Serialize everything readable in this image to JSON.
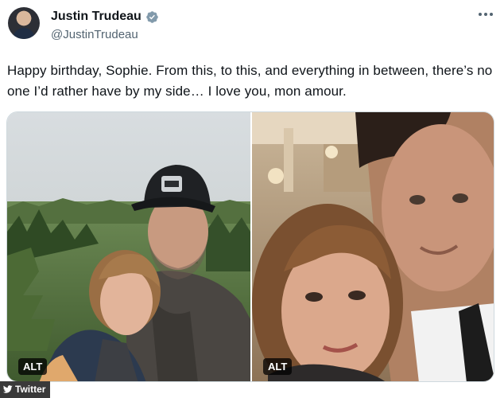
{
  "author": {
    "display_name": "Justin Trudeau",
    "handle": "@JustinTrudeau",
    "verified_icon": "verified-badge-icon",
    "avatar": "profile-photo"
  },
  "tweet": {
    "text": "Happy birthday, Sophie. From this, to this, and everything in between, there’s no one I’d rather have by my side… I love you, mon amour."
  },
  "media": {
    "photos": [
      {
        "alt_label": "ALT",
        "description_icon": "forest-selfie-photo"
      },
      {
        "alt_label": "ALT",
        "description_icon": "indoor-selfie-photo"
      }
    ]
  },
  "watermark": {
    "label": "Twitter",
    "icon": "twitter-bird-icon"
  },
  "colors": {
    "text_primary": "#0f1419",
    "text_secondary": "#536471",
    "verified_gray": "#829aab",
    "border": "#cfd9de"
  }
}
